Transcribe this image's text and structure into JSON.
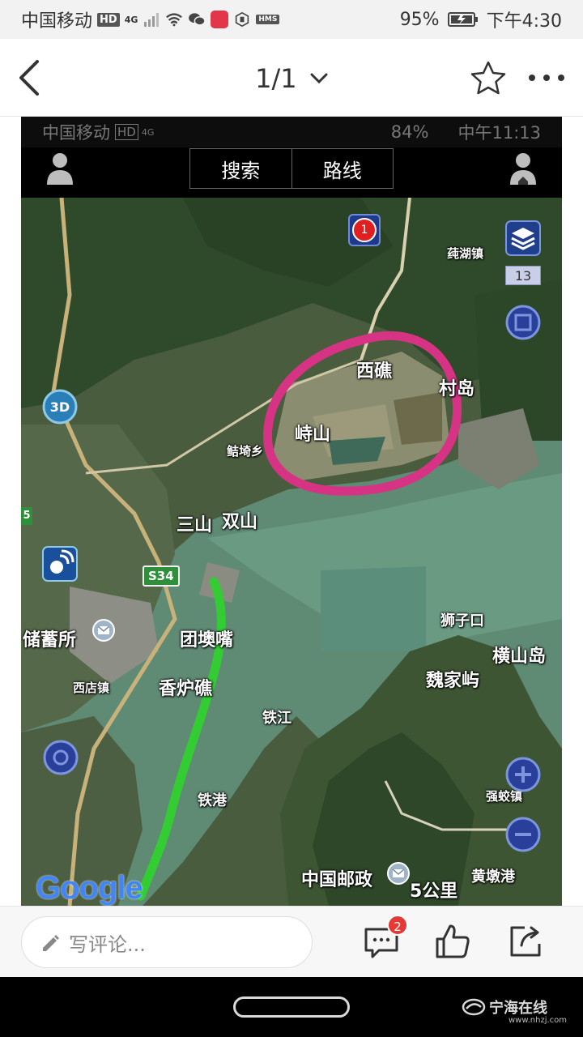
{
  "status_bar": {
    "carrier": "中国移动",
    "hd_badge": "HD",
    "network": "4G",
    "hms_badge": "HMS",
    "battery": "95%",
    "time": "下午4:30"
  },
  "nav": {
    "page_indicator": "1/1",
    "back_icon": "chevron-left-icon",
    "dropdown_icon": "chevron-down-icon",
    "favorite_icon": "star-icon",
    "more_icon": "more-horizontal-icon"
  },
  "map_screenshot": {
    "inner_status": {
      "carrier": "中国移动",
      "hd_badge": "HD",
      "network": "4G",
      "battery": "84%",
      "time": "中午11:13"
    },
    "tabs": [
      "搜索",
      "路线"
    ],
    "zoom_level": "13",
    "notification_count": "1",
    "road_badge": "S34",
    "edge_badge": "5",
    "mode_3d": "3D",
    "google_logo": "Google",
    "labels": {
      "xiqiao": "西礁",
      "zhushan": "峙山",
      "cundao": "村岛",
      "chihuzhen": "莼湖镇",
      "jieqixiang": "鲒埼乡",
      "sanshan": "三山",
      "shuangshan": "双山",
      "chuxusuo": "储蓄所",
      "tuanxu": "团墺嘴",
      "xianglu": "香炉礁",
      "xidianzhen": "西店镇",
      "tiejiang": "铁江",
      "tiegang": "铁港",
      "shizikou": "狮子口",
      "hengshandao": "横山岛",
      "weijiayu": "魏家屿",
      "qiangjiaozhen": "强蛟镇",
      "zhongguoyouzheng": "中国邮政",
      "scale": "5公里",
      "huangdungang": "黄墩港"
    },
    "colors": {
      "circle_annotation": "#d63384",
      "route_annotation": "#33cc33"
    }
  },
  "bottom_bar": {
    "comment_placeholder": "写评论...",
    "comment_count": "2"
  },
  "watermark": {
    "name": "宁海在线",
    "url": "www.nhzj.com"
  }
}
